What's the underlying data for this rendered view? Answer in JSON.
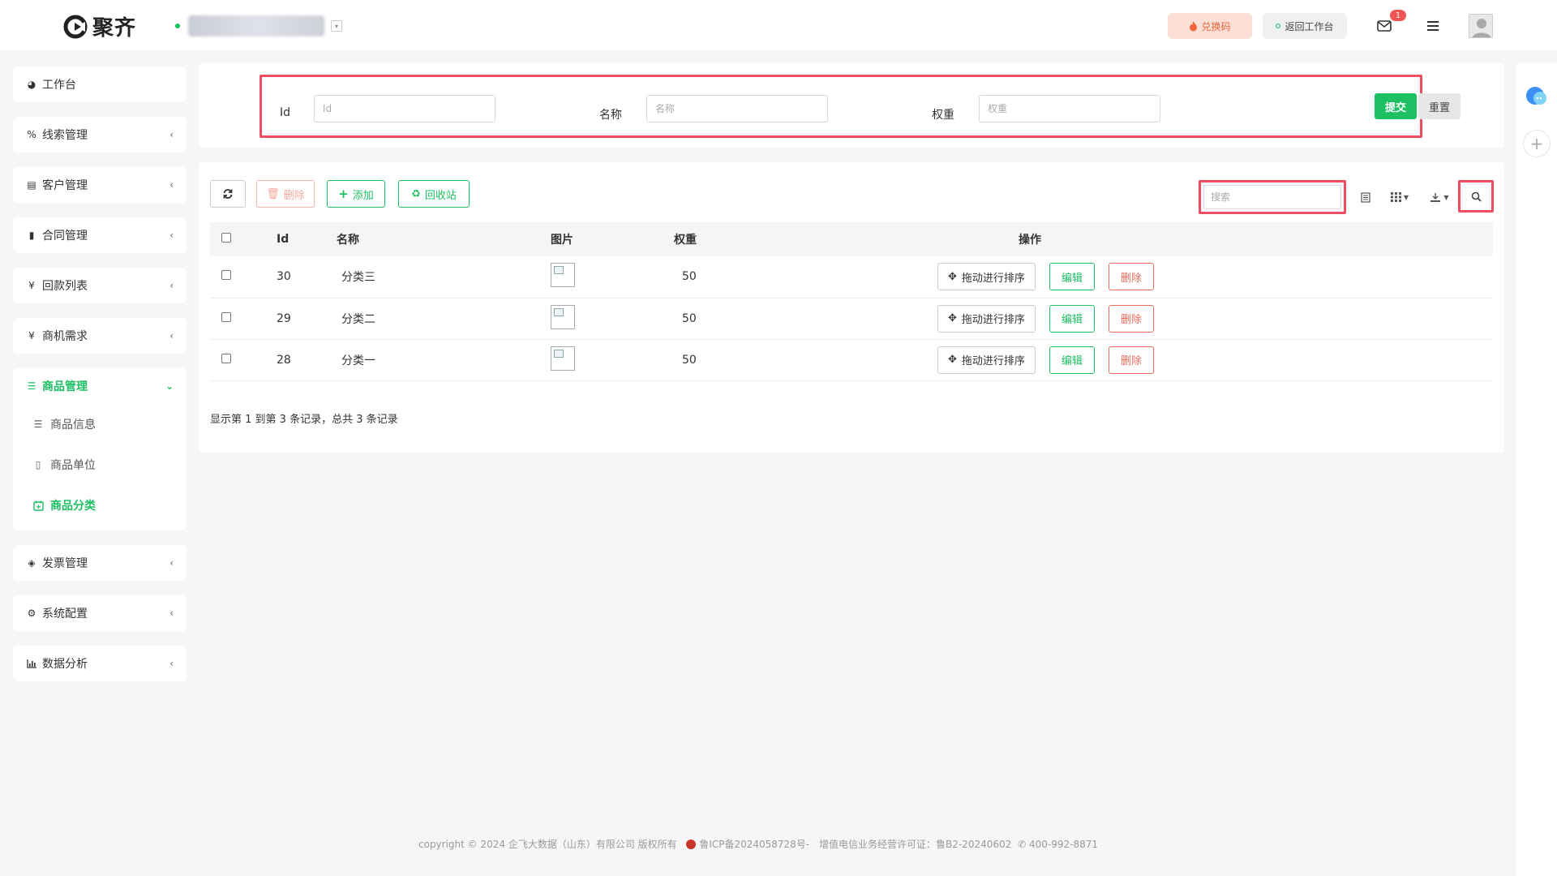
{
  "header": {
    "logo_text": "聚齐",
    "redeem_label": "兑换码",
    "back_label": "返回工作台",
    "mail_badge": "1"
  },
  "sidebar": {
    "items": [
      {
        "label": "工作台",
        "icon": "dashboard-icon"
      },
      {
        "label": "线索管理",
        "icon": "percent-icon"
      },
      {
        "label": "客户管理",
        "icon": "id-card-icon"
      },
      {
        "label": "合同管理",
        "icon": "bookmark-icon"
      },
      {
        "label": "回款列表",
        "icon": "yen-icon"
      },
      {
        "label": "商机需求",
        "icon": "yen-icon"
      }
    ],
    "active_group": {
      "label": "商品管理",
      "icon": "list-icon",
      "children": [
        {
          "label": "商品信息",
          "icon": "indent-icon"
        },
        {
          "label": "商品单位",
          "icon": "book-icon"
        },
        {
          "label": "商品分类",
          "icon": "calendar-plus-icon",
          "active": true
        }
      ]
    },
    "items_after": [
      {
        "label": "发票管理",
        "icon": "tag-icon"
      },
      {
        "label": "系统配置",
        "icon": "gears-icon"
      },
      {
        "label": "数据分析",
        "icon": "bar-chart-icon"
      }
    ]
  },
  "filter": {
    "id_label": "Id",
    "id_placeholder": "Id",
    "name_label": "名称",
    "name_placeholder": "名称",
    "weight_label": "权重",
    "weight_placeholder": "权重",
    "submit_label": "提交",
    "reset_label": "重置"
  },
  "toolbar": {
    "delete_label": "删除",
    "add_label": "添加",
    "recycle_label": "回收站",
    "search_placeholder": "搜索"
  },
  "table": {
    "columns": [
      "Id",
      "名称",
      "图片",
      "权重",
      "操作"
    ],
    "rows": [
      {
        "id": "30",
        "name": "分类三",
        "weight": "50"
      },
      {
        "id": "29",
        "name": "分类二",
        "weight": "50"
      },
      {
        "id": "28",
        "name": "分类一",
        "weight": "50"
      }
    ],
    "actions": {
      "drag": "拖动进行排序",
      "edit": "编辑",
      "delete": "删除"
    }
  },
  "pager_info": "显示第 1 到第 3 条记录，总共 3 条记录",
  "footer": {
    "copyright": "copyright © 2024 企飞大数据（山东）有限公司 版权所有",
    "icp": "鲁ICP备2024058728号-",
    "license": "增值电信业务经营许可证：鲁B2-20240602",
    "phone": "400-992-8871"
  },
  "colors": {
    "accent": "#1dbf63",
    "danger": "#ef6b5a",
    "highlight_box": "#ee4d63"
  }
}
